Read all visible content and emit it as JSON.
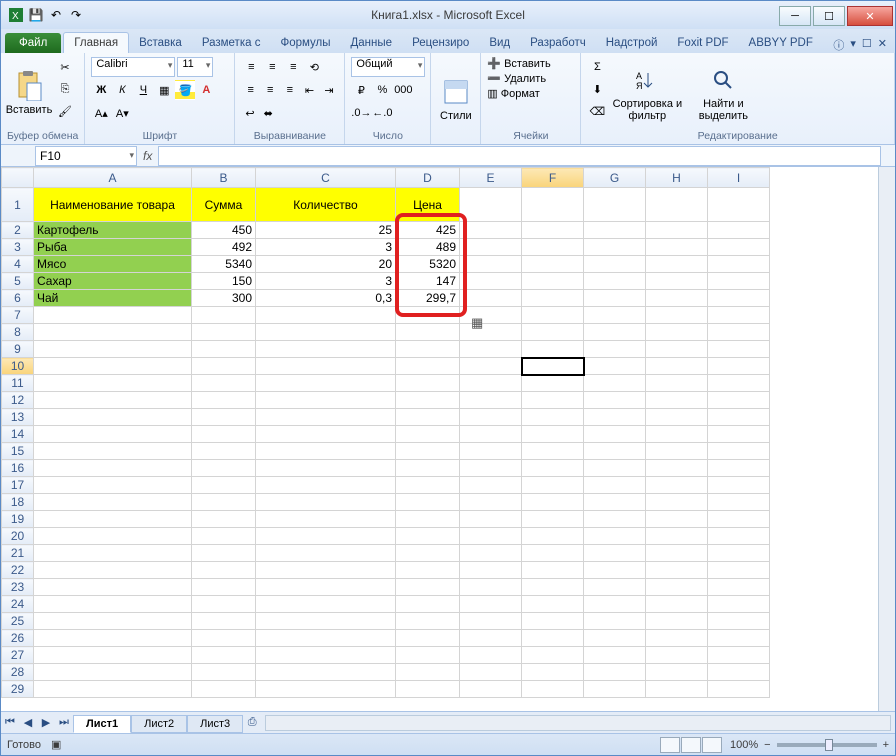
{
  "window": {
    "title": "Книга1.xlsx - Microsoft Excel"
  },
  "qat": {
    "save": "💾",
    "undo": "↶",
    "redo": "↷"
  },
  "tabs": {
    "file": "Файл",
    "items": [
      "Главная",
      "Вставка",
      "Разметка с",
      "Формулы",
      "Данные",
      "Рецензиро",
      "Вид",
      "Разработч",
      "Надстрой",
      "Foxit PDF",
      "ABBYY PDF"
    ],
    "active": 0
  },
  "ribbon": {
    "clipboard": {
      "paste": "Вставить",
      "label": "Буфер обмена"
    },
    "font": {
      "name": "Calibri",
      "size": "11",
      "label": "Шрифт"
    },
    "align": {
      "label": "Выравнивание"
    },
    "number": {
      "format": "Общий",
      "label": "Число"
    },
    "styles": {
      "btn": "Стили",
      "label": ""
    },
    "cells": {
      "insert": "Вставить",
      "delete": "Удалить",
      "format": "Формат",
      "label": "Ячейки"
    },
    "editing": {
      "sort": "Сортировка и фильтр",
      "find": "Найти и выделить",
      "label": "Редактирование"
    }
  },
  "formula_bar": {
    "name_box": "F10",
    "fx": "fx",
    "formula": ""
  },
  "columns": [
    "A",
    "B",
    "C",
    "D",
    "E",
    "F",
    "G",
    "H",
    "I"
  ],
  "headers": {
    "A": "Наименование товара",
    "B": "Сумма",
    "C": "Количество",
    "D": "Цена"
  },
  "rows": [
    {
      "A": "Картофель",
      "B": "450",
      "C": "25",
      "D": "425"
    },
    {
      "A": "Рыба",
      "B": "492",
      "C": "3",
      "D": "489"
    },
    {
      "A": "Мясо",
      "B": "5340",
      "C": "20",
      "D": "5320"
    },
    {
      "A": "Сахар",
      "B": "150",
      "C": "3",
      "D": "147"
    },
    {
      "A": "Чай",
      "B": "300",
      "C": "0,3",
      "D": "299,7"
    }
  ],
  "selected_cell": "F10",
  "sheets": {
    "items": [
      "Лист1",
      "Лист2",
      "Лист3"
    ],
    "active": 0
  },
  "status": {
    "ready": "Готово",
    "zoom": "100%",
    "zoom_minus": "−",
    "zoom_plus": "+"
  },
  "chart_data": {
    "type": "table",
    "columns": [
      "Наименование товара",
      "Сумма",
      "Количество",
      "Цена"
    ],
    "rows": [
      [
        "Картофель",
        450,
        25,
        425
      ],
      [
        "Рыба",
        492,
        3,
        489
      ],
      [
        "Мясо",
        5340,
        20,
        5320
      ],
      [
        "Сахар",
        150,
        3,
        147
      ],
      [
        "Чай",
        300,
        0.3,
        299.7
      ]
    ]
  }
}
